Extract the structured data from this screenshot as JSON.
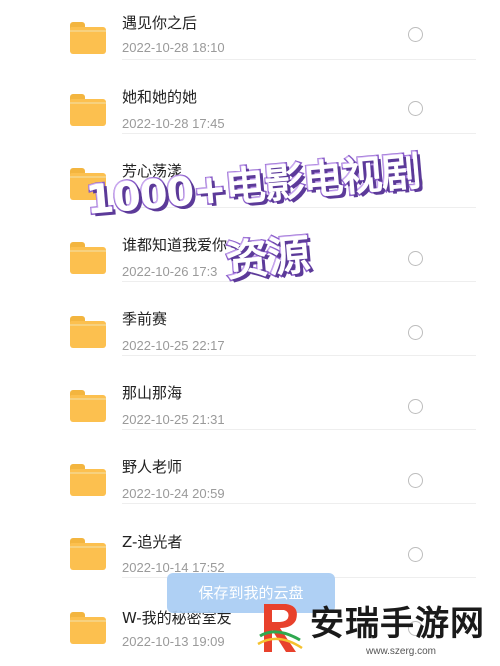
{
  "files": [
    {
      "name": "遇见你之后",
      "date": "2022-10-28 18:10"
    },
    {
      "name": "她和她的她",
      "date": "2022-10-28 17:45"
    },
    {
      "name": "芳心荡漾",
      "date": ""
    },
    {
      "name": "谁都知道我爱你",
      "date": "2022-10-26 17:3"
    },
    {
      "name": "季前赛",
      "date": "2022-10-25 22:17"
    },
    {
      "name": "那山那海",
      "date": "2022-10-25 21:31"
    },
    {
      "name": "野人老师",
      "date": "2022-10-24 20:59"
    },
    {
      "name": "Z-追光者",
      "date": "2022-10-14 17:52"
    },
    {
      "name": "W-我的秘密室友",
      "date": "2022-10-13 19:09"
    }
  ],
  "overlay": {
    "line1": "1000+电影电视剧",
    "line2": "资源"
  },
  "save_button": {
    "label": "保存到我的云盘"
  },
  "watermark": {
    "text": "安瑞手游网",
    "url": "www.szerg.com"
  },
  "colors": {
    "folder": "#fcc04f",
    "overlay_stroke": "#8a5ec9",
    "save_button": "#a9cdf4"
  },
  "icons": [
    "folder-icon",
    "radio-circle-icon",
    "watermark-logo-icon"
  ]
}
